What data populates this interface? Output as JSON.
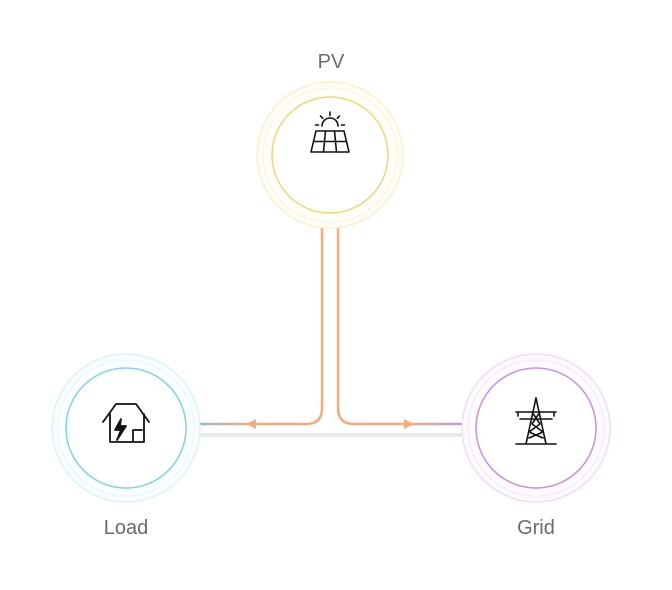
{
  "nodes": {
    "pv": {
      "label": "PV",
      "icon": "solar-panel-icon",
      "ring_color": "#f5d66b",
      "halo_color": "#fbf1c8"
    },
    "load": {
      "label": "Load",
      "icon": "house-bolt-icon",
      "ring_color": "#7dd3f0",
      "halo_color": "#dcf2fb"
    },
    "grid": {
      "label": "Grid",
      "icon": "transmission-tower-icon",
      "ring_color": "#c98cf2",
      "halo_color": "#eedcfb"
    }
  },
  "flows": {
    "pv_to_load": {
      "color_from": "#f6ac7a",
      "color_to": "#5ec3ee"
    },
    "pv_to_grid": {
      "color_from": "#f6ac7a",
      "color_to": "#9b9df6"
    },
    "load_grid_base": {
      "color": "#e8e8e8"
    }
  }
}
